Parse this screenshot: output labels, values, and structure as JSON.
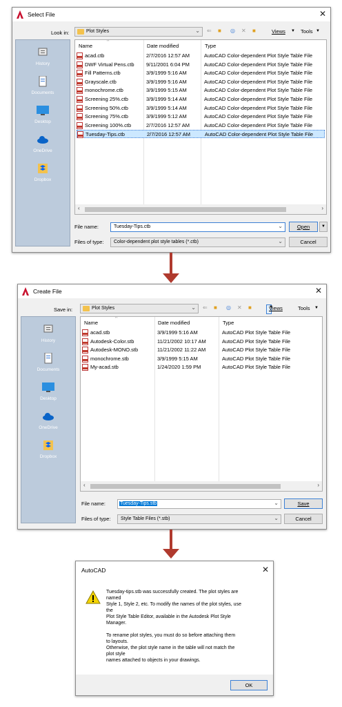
{
  "select_file": {
    "title": "Select File",
    "look_in_label": "Look in:",
    "look_in_value": "Plot Styles",
    "views_label": "Views",
    "tools_label": "Tools",
    "places": [
      "History",
      "Documents",
      "Desktop",
      "OneDrive",
      "Dropbox"
    ],
    "columns": [
      "Name",
      "Date modified",
      "Type"
    ],
    "files": [
      {
        "name": "acad.ctb",
        "date": "2/7/2016 12:57 AM",
        "type": "AutoCAD Color-dependent Plot Style Table File"
      },
      {
        "name": "DWF Virtual Pens.ctb",
        "date": "9/11/2001 6:04 PM",
        "type": "AutoCAD Color-dependent Plot Style Table File"
      },
      {
        "name": "Fill Patterns.ctb",
        "date": "3/9/1999 5:16 AM",
        "type": "AutoCAD Color-dependent Plot Style Table File"
      },
      {
        "name": "Grayscale.ctb",
        "date": "3/9/1999 5:16 AM",
        "type": "AutoCAD Color-dependent Plot Style Table File"
      },
      {
        "name": "monochrome.ctb",
        "date": "3/9/1999 5:15 AM",
        "type": "AutoCAD Color-dependent Plot Style Table File"
      },
      {
        "name": "Screening 25%.ctb",
        "date": "3/9/1999 5:14 AM",
        "type": "AutoCAD Color-dependent Plot Style Table File"
      },
      {
        "name": "Screening 50%.ctb",
        "date": "3/9/1999 5:14 AM",
        "type": "AutoCAD Color-dependent Plot Style Table File"
      },
      {
        "name": "Screening 75%.ctb",
        "date": "3/9/1999 5:12 AM",
        "type": "AutoCAD Color-dependent Plot Style Table File"
      },
      {
        "name": "Screening 100%.ctb",
        "date": "2/7/2016 12:57 AM",
        "type": "AutoCAD Color-dependent Plot Style Table File"
      },
      {
        "name": "Tuesday-Tips.ctb",
        "date": "2/7/2016 12:57 AM",
        "type": "AutoCAD Color-dependent Plot Style Table File"
      }
    ],
    "file_name_label": "File name:",
    "file_name_value": "Tuesday-Tips.ctb",
    "files_of_type_label": "Files of type:",
    "files_of_type_value": "Color-dependent plot style tables (*.ctb)",
    "open_label": "Open",
    "cancel_label": "Cancel"
  },
  "create_file": {
    "title": "Create File",
    "save_in_label": "Save in:",
    "save_in_value": "Plot Styles",
    "views_label": "Views",
    "tools_label": "Tools",
    "places": [
      "History",
      "Documents",
      "Desktop",
      "OneDrive",
      "Dropbox"
    ],
    "columns": [
      "Name",
      "Date modified",
      "Type"
    ],
    "files": [
      {
        "name": "acad.stb",
        "date": "3/9/1999 5:16 AM",
        "type": "AutoCAD Plot Style Table File"
      },
      {
        "name": "Autodesk-Color.stb",
        "date": "11/21/2002 10:17 AM",
        "type": "AutoCAD Plot Style Table File"
      },
      {
        "name": "Autodesk-MONO.stb",
        "date": "11/21/2002 11:22 AM",
        "type": "AutoCAD Plot Style Table File"
      },
      {
        "name": "monochrome.stb",
        "date": "3/9/1999 5:15 AM",
        "type": "AutoCAD Plot Style Table File"
      },
      {
        "name": "My-acad.stb",
        "date": "1/24/2020 1:59 PM",
        "type": "AutoCAD Plot Style Table File"
      }
    ],
    "file_name_label": "File name:",
    "file_name_value": "Tuesday-Tips.stb",
    "files_of_type_label": "Files of type:",
    "files_of_type_value": "Style Table Files (*.stb)",
    "save_label": "Save",
    "cancel_label": "Cancel"
  },
  "autocad_msg": {
    "title": "AutoCAD",
    "lines": [
      "Tuesday-tips.stb was successfully created.  The plot styles are",
      "named",
      "Style 1, Style 2, etc.  To modify the names of the plot styles, use",
      "the",
      "Plot Style Table Editor, available in the Autodesk Plot Style",
      "Manager.",
      "",
      "To rename plot styles, you must do so before attaching them",
      "to layouts.",
      "Otherwise, the plot style name in the table will not match the",
      "plot style",
      "names attached to objects in your drawings."
    ],
    "ok_label": "OK"
  },
  "colors": {
    "arrow": "#b03a2e",
    "places_panel": "#bccbdc",
    "selection": "#cce8ff"
  }
}
